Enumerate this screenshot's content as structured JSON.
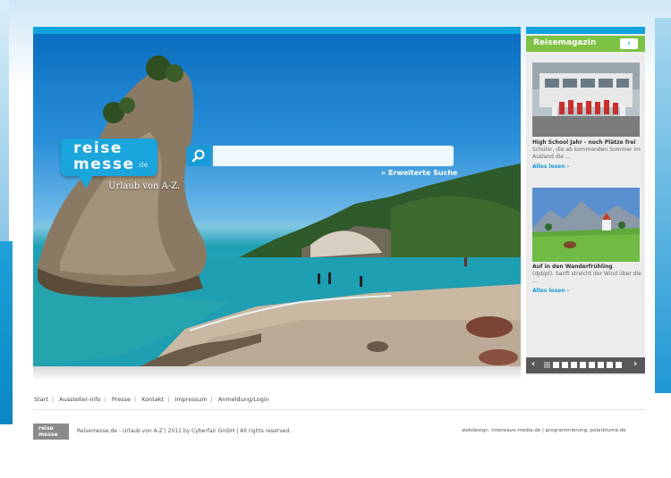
{
  "logo": {
    "line1": "reise",
    "line2": "messe",
    "tld": ".de"
  },
  "tagline": "Urlaub von A-Z.",
  "search": {
    "placeholder": "",
    "advanced_label": "» Erweiterte Suche"
  },
  "magazine": {
    "title": "Reisemagazin",
    "next_label": "›",
    "articles": [
      {
        "title": "High School Jahr - noch Plätze frei",
        "text": "Schüler, die ab kommenden Sommer im Ausland die ...",
        "more": "Alles lesen ›"
      },
      {
        "title": "Auf in den Wanderfrühling",
        "text": "(djd/pt). Sanft streicht der Wind über die ...",
        "more": "Alles lesen ›"
      }
    ],
    "pager": {
      "prev": "‹",
      "next": "›"
    }
  },
  "nav": [
    "Start",
    "Aussteller-Info",
    "Presse",
    "Kontakt",
    "Impressum",
    "Anmeldung/Login"
  ],
  "nav_sep": "|",
  "footer": {
    "logo_line1": "reise",
    "logo_line2": "messe",
    "copyright": "Reisemesse.de - Urlaub von A-Z | 2011 by Cyberfair GmbH | All rights reserved.",
    "credits": "webdesign: interwave-media.de | programmierung: polarblume.de"
  },
  "colors": {
    "accent": "#11a4dd",
    "green": "#7dc242",
    "pager": "#595959"
  }
}
